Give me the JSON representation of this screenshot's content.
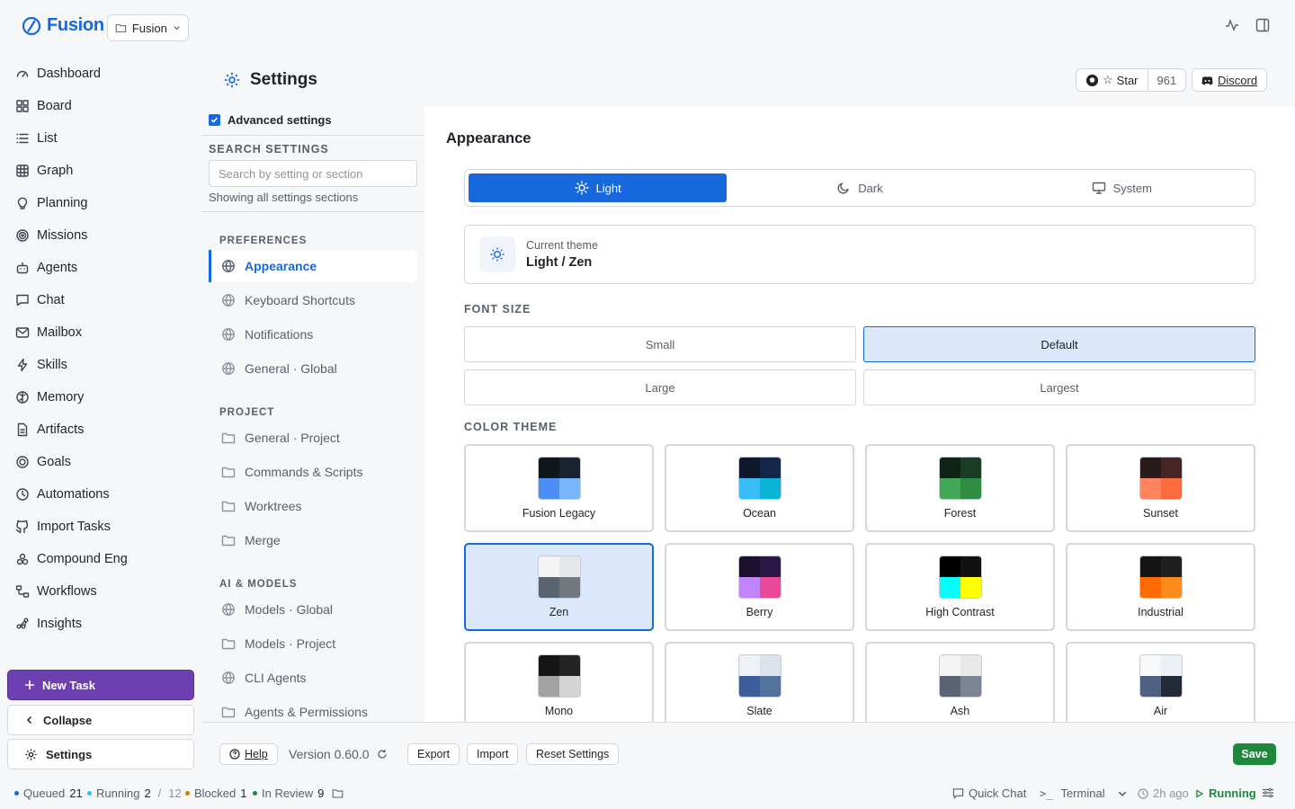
{
  "app": {
    "name": "Fusion",
    "project": "Fusion",
    "brand_color": "#1668dc"
  },
  "nav": [
    {
      "label": "Dashboard",
      "icon": "gauge-icon"
    },
    {
      "label": "Board",
      "icon": "board-icon"
    },
    {
      "label": "List",
      "icon": "list-icon"
    },
    {
      "label": "Graph",
      "icon": "table-icon"
    },
    {
      "label": "Planning",
      "icon": "lightbulb-icon"
    },
    {
      "label": "Missions",
      "icon": "target-icon"
    },
    {
      "label": "Agents",
      "icon": "bot-icon"
    },
    {
      "label": "Chat",
      "icon": "chat-icon"
    },
    {
      "label": "Mailbox",
      "icon": "mail-icon"
    },
    {
      "label": "Skills",
      "icon": "bolt-icon"
    },
    {
      "label": "Memory",
      "icon": "brain-icon"
    },
    {
      "label": "Artifacts",
      "icon": "file-icon"
    },
    {
      "label": "Goals",
      "icon": "goal-icon"
    },
    {
      "label": "Automations",
      "icon": "clock-icon"
    },
    {
      "label": "Import Tasks",
      "icon": "github-icon"
    },
    {
      "label": "Compound Eng",
      "icon": "compound-icon"
    },
    {
      "label": "Workflows",
      "icon": "workflow-icon"
    },
    {
      "label": "Insights",
      "icon": "insights-icon"
    }
  ],
  "sidebar_actions": {
    "new_task": "New Task",
    "collapse": "Collapse",
    "settings": "Settings"
  },
  "header": {
    "title": "Settings",
    "star_label": "Star",
    "star_count": "961",
    "discord": "Discord"
  },
  "settings_side": {
    "advanced": "Advanced settings",
    "search_heading": "SEARCH SETTINGS",
    "search_placeholder": "Search by setting or section",
    "search_status": "Showing all settings sections",
    "sections": [
      {
        "heading": "PREFERENCES",
        "items": [
          {
            "label": "Appearance",
            "icon": "globe-icon"
          },
          {
            "label": "Keyboard Shortcuts",
            "icon": "globe-icon"
          },
          {
            "label": "Notifications",
            "icon": "globe-icon"
          },
          {
            "label": "General · Global",
            "icon": "globe-icon"
          }
        ]
      },
      {
        "heading": "PROJECT",
        "items": [
          {
            "label": "General · Project",
            "icon": "folder-icon"
          },
          {
            "label": "Commands & Scripts",
            "icon": "folder-icon"
          },
          {
            "label": "Worktrees",
            "icon": "folder-icon"
          },
          {
            "label": "Merge",
            "icon": "folder-icon"
          }
        ]
      },
      {
        "heading": "AI & MODELS",
        "items": [
          {
            "label": "Models · Global",
            "icon": "globe-icon"
          },
          {
            "label": "Models · Project",
            "icon": "folder-icon"
          },
          {
            "label": "CLI Agents",
            "icon": "globe-icon"
          },
          {
            "label": "Agents & Permissions",
            "icon": "folder-icon"
          }
        ]
      }
    ],
    "active": "Appearance"
  },
  "appearance": {
    "title": "Appearance",
    "modes": [
      {
        "label": "Light",
        "icon": "sun-icon",
        "active": true
      },
      {
        "label": "Dark",
        "icon": "moon-icon",
        "active": false
      },
      {
        "label": "System",
        "icon": "monitor-icon",
        "active": false
      }
    ],
    "current_theme_label": "Current theme",
    "current_theme_value": "Light / Zen",
    "font_size_heading": "FONT SIZE",
    "font_sizes": [
      {
        "label": "Small",
        "active": false
      },
      {
        "label": "Default",
        "active": true
      },
      {
        "label": "Large",
        "active": false
      },
      {
        "label": "Largest",
        "active": false
      }
    ],
    "color_theme_heading": "COLOR THEME",
    "themes": [
      {
        "name": "Fusion Legacy",
        "colors": [
          "#12161d",
          "#1b2230",
          "#4c8ef7",
          "#7ab4fb"
        ],
        "active": false
      },
      {
        "name": "Ocean",
        "colors": [
          "#0e1a2b",
          "#12284a",
          "#38bdf8",
          "#06b6d4"
        ],
        "active": false
      },
      {
        "name": "Forest",
        "colors": [
          "#102318",
          "#1a3b24",
          "#43a856",
          "#2f8c42"
        ],
        "active": false
      },
      {
        "name": "Sunset",
        "colors": [
          "#2b1a1a",
          "#472525",
          "#ff845e",
          "#ff6a3d"
        ],
        "active": false
      },
      {
        "name": "Zen",
        "colors": [
          "#f4f4f5",
          "#e6e7e9",
          "#5a6473",
          "#717880"
        ],
        "active": true
      },
      {
        "name": "Berry",
        "colors": [
          "#1d0f2e",
          "#2c1847",
          "#c084fc",
          "#ec4899"
        ],
        "active": false
      },
      {
        "name": "High Contrast",
        "colors": [
          "#000000",
          "#111111",
          "#00ffff",
          "#ffff00"
        ],
        "active": false
      },
      {
        "name": "Industrial",
        "colors": [
          "#141414",
          "#1f1f1f",
          "#ff6a00",
          "#ff8c1a"
        ],
        "active": false
      },
      {
        "name": "Mono",
        "colors": [
          "#151515",
          "#232323",
          "#a3a3a3",
          "#d4d4d4"
        ],
        "active": false
      },
      {
        "name": "Slate",
        "colors": [
          "#eef1f6",
          "#dde3ec",
          "#3e5c9a",
          "#55729e"
        ],
        "active": false
      },
      {
        "name": "Ash",
        "colors": [
          "#f4f4f4",
          "#e8e8e8",
          "#5b6474",
          "#7a8493"
        ],
        "active": false
      },
      {
        "name": "Air",
        "colors": [
          "#f7f8fa",
          "#eceff3",
          "#4e6180",
          "#232b38"
        ],
        "active": false
      }
    ]
  },
  "footer": {
    "help": "Help",
    "version": "Version 0.60.0",
    "export": "Export",
    "import": "Import",
    "reset": "Reset Settings",
    "save": "Save"
  },
  "status": {
    "queued_label": "Queued",
    "queued": "21",
    "running_label": "Running",
    "running": "2",
    "running_sep": "/",
    "running_total": "12",
    "blocked_label": "Blocked",
    "blocked": "1",
    "review_label": "In Review",
    "review": "9",
    "quick_chat": "Quick Chat",
    "terminal": "Terminal",
    "last_run": "2h ago",
    "state": "Running"
  }
}
